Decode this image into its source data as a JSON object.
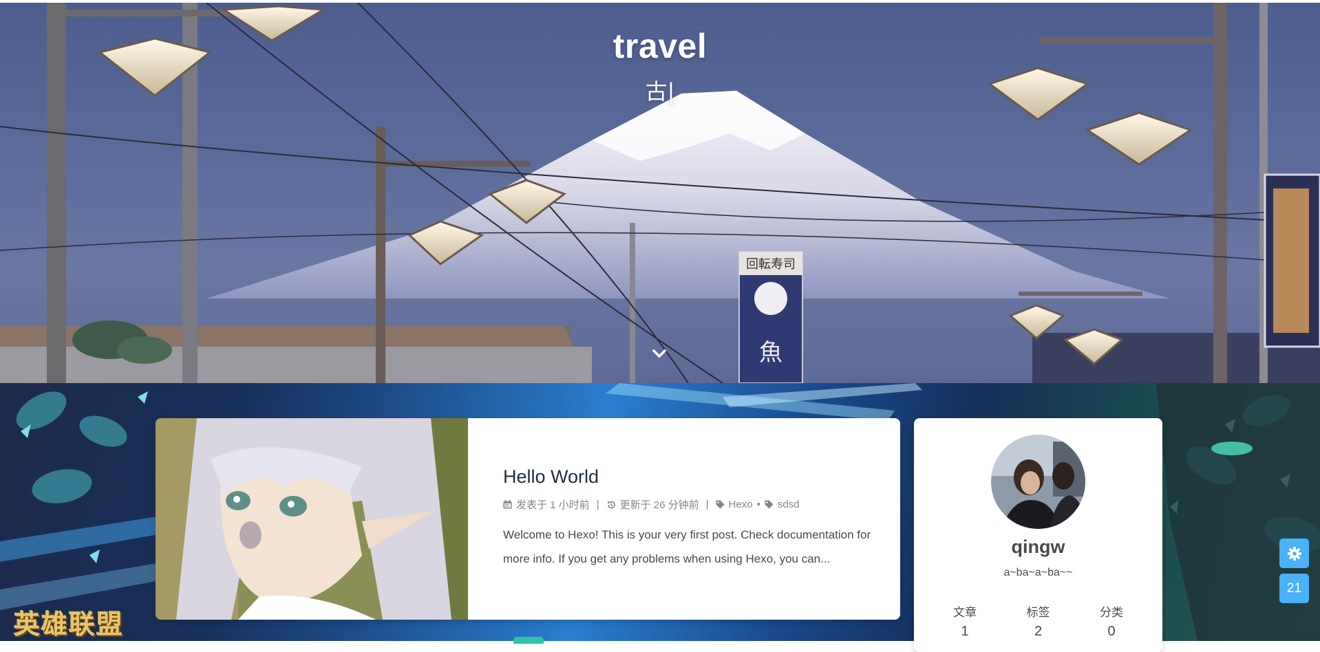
{
  "hero": {
    "title": "travel",
    "subtitle": "古|",
    "scroll_icon": "chevron-down-icon"
  },
  "posts": [
    {
      "title": "Hello World",
      "meta": {
        "published_icon": "calendar-icon",
        "published": "发表于 1 小时前",
        "updated_icon": "history-icon",
        "updated": "更新于 26 分钟前",
        "tag_icon": "tag-icon",
        "tags": [
          "Hexo",
          "sdsd"
        ],
        "separator": "|",
        "tag_separator": "•"
      },
      "excerpt": "Welcome to Hexo! This is your very first post. Check documentation for more info. If you get any problems when using Hexo, you can..."
    }
  ],
  "author": {
    "name": "qingw",
    "description": "a~ba~a~ba~~",
    "stats": [
      {
        "label": "文章",
        "value": "1"
      },
      {
        "label": "标签",
        "value": "2"
      },
      {
        "label": "分类",
        "value": "0"
      }
    ]
  },
  "background": {
    "logo_text": "英雄联盟"
  },
  "right_side": {
    "settings_icon": "gear-icon",
    "read_percent": "21"
  },
  "colors": {
    "accent": "#49b1f5",
    "title_text": "#1f2d3d",
    "meta_text": "#858585",
    "body_text": "#4c4948"
  }
}
